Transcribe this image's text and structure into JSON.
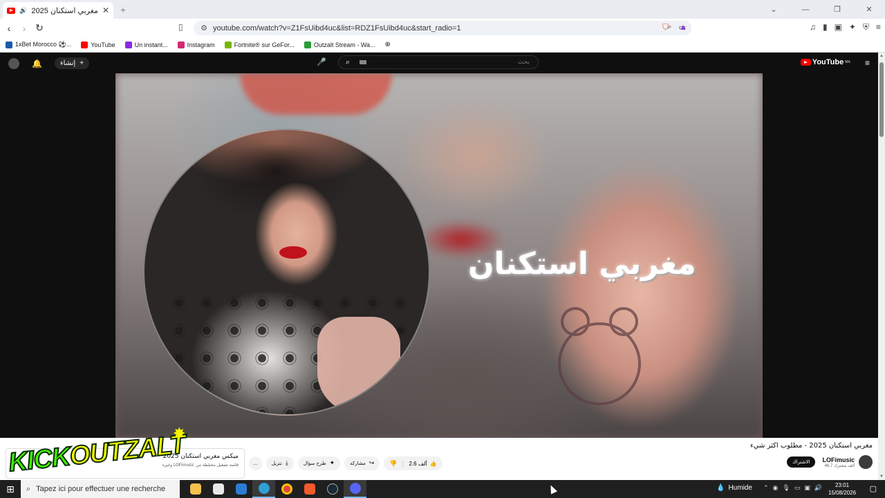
{
  "browser": {
    "tab": {
      "title": "مغربي استكنان 2025 - مطلوب اكثر شيء"
    },
    "url": "youtube.com/watch?v=Z1FsUibd4uc&list=RDZ1FsUibd4uc&start_radio=1",
    "bookmarks": [
      "1xBet Morocco ⚽...",
      "YouTube",
      "Un instant...",
      "Instagram",
      "Fortnite® sur GeFor...",
      "Outzalt Stream - Wa..."
    ],
    "bookmark_colors": [
      "#1a5ca8",
      "#ff0000",
      "#8a2be2",
      "#d62976",
      "#76b900",
      "#2a9d3a"
    ]
  },
  "youtube": {
    "create_label": "إنشاء",
    "search_placeholder": "بحث",
    "logo_text": "YouTube",
    "logo_region": "MA",
    "video": {
      "art_title": "مغربي استكنان",
      "title": "مغربي استكنان 2025 - مطلوب اكثر شيء",
      "channel": "LOFimusic",
      "subscribers": "46.7 ألف مشترك",
      "subscribe_label": "الاشتراك",
      "likes": "2.6 ألف",
      "share_label": "مشاركة",
      "ask_label": "طرح سؤال",
      "download_label": "تنزيل",
      "more_label": "..."
    },
    "mix_card": {
      "title": "ميكس مغربي استكنان 2025",
      "subtitle": "قائمة تشغيل مختلطة من LOFimusic وغيره"
    }
  },
  "overlay": {
    "kick_text_a": "KICK",
    "kick_text_b": "OUTZALT"
  },
  "taskbar": {
    "search_placeholder": "Tapez ici pour effectuer une recherche",
    "weather": "Humide",
    "time": "23:01",
    "date": "15/08/2026"
  }
}
